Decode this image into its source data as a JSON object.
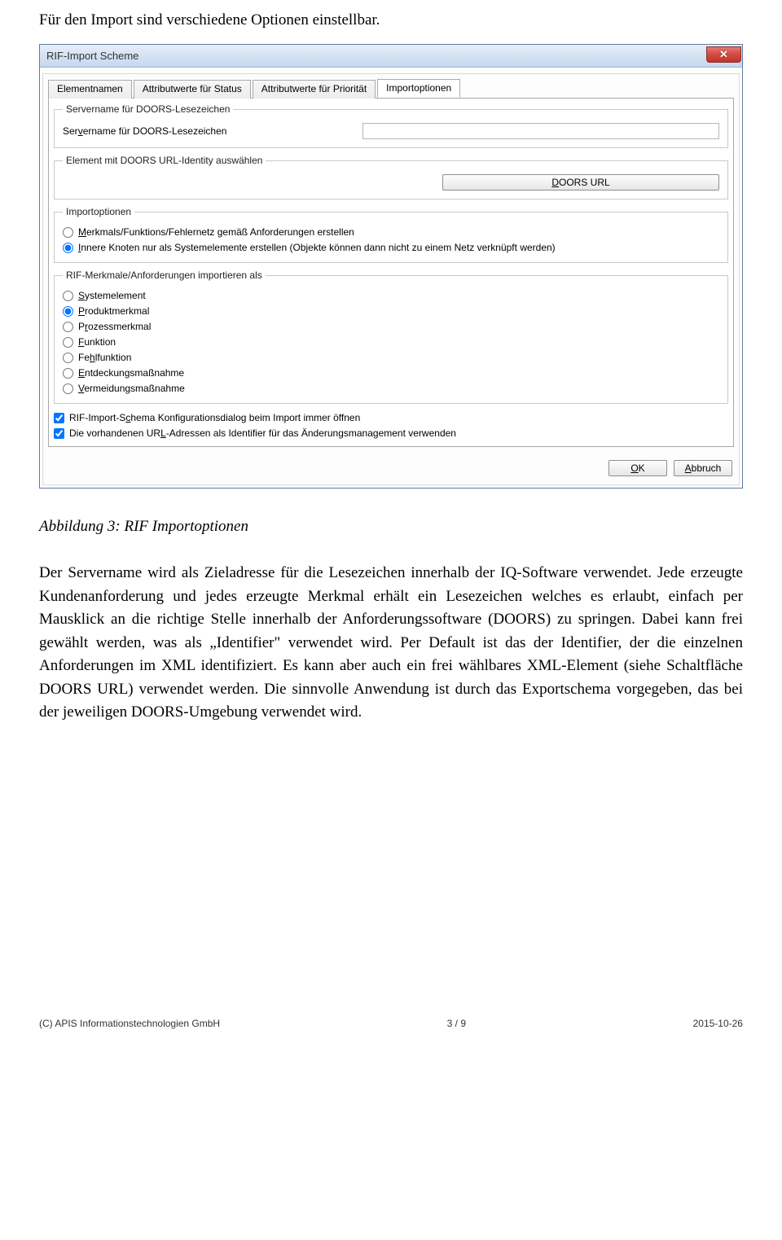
{
  "intro": "Für den Import sind verschiedene Optionen einstellbar.",
  "caption": "Abbildung 3: RIF Importoptionen",
  "body": "Der Servername wird als Zieladresse für die Lesezeichen innerhalb der IQ-Software verwendet. Jede erzeugte Kundenanforderung und jedes erzeugte Merkmal erhält ein Lesezeichen welches es erlaubt, einfach per Mausklick an die richtige Stelle innerhalb der Anforderungssoftware (DOORS) zu springen. Dabei kann frei gewählt werden, was als „Identifier\" verwendet wird. Per Default ist das der Identifier, der die einzelnen Anforderungen im XML identifiziert. Es kann aber auch ein frei wählbares XML-Element (siehe Schaltfläche DOORS URL) verwendet werden. Die sinnvolle Anwendung ist durch das Exportschema vorgegeben, das bei der jeweiligen DOORS-Umgebung verwendet wird.",
  "dialog": {
    "title": "RIF-Import Scheme",
    "tabs": {
      "t1": "Elementnamen",
      "t2": "Attributwerte für Status",
      "t3": "Attributwerte für Priorität",
      "t4": "Importoptionen"
    },
    "group1": {
      "legend": "Servername für DOORS-Lesezeichen",
      "label": "Servername für DOORS-Lesezeichen",
      "value": ""
    },
    "group2": {
      "legend": "Element mit DOORS URL-Identity auswählen",
      "button": "DOORS URL"
    },
    "group3": {
      "legend": "Importoptionen",
      "opt1": "Merkmals/Funktions/Fehlernetz gemäß Anforderungen erstellen",
      "opt2": "Innere Knoten nur als Systemelemente erstellen (Objekte können dann nicht zu einem Netz verknüpft werden)"
    },
    "group4": {
      "legend": "RIF-Merkmale/Anforderungen importieren als",
      "r1": "Systemelement",
      "r2": "Produktmerkmal",
      "r3": "Prozessmerkmal",
      "r4": "Funktion",
      "r5": "Fehlfunktion",
      "r6": "Entdeckungsmaßnahme",
      "r7": "Vermeidungsmaßnahme"
    },
    "checks": {
      "c1": "RIF-Import-Schema Konfigurationsdialog beim Import immer öffnen",
      "c2": "Die vorhandenen URL-Adressen als Identifier für das Änderungsmanagement verwenden"
    },
    "footer": {
      "ok": "OK",
      "cancel": "Abbruch"
    }
  },
  "page_footer": {
    "left": "(C) APIS Informationstechnologien GmbH",
    "center": "3 / 9",
    "right": "2015-10-26"
  }
}
